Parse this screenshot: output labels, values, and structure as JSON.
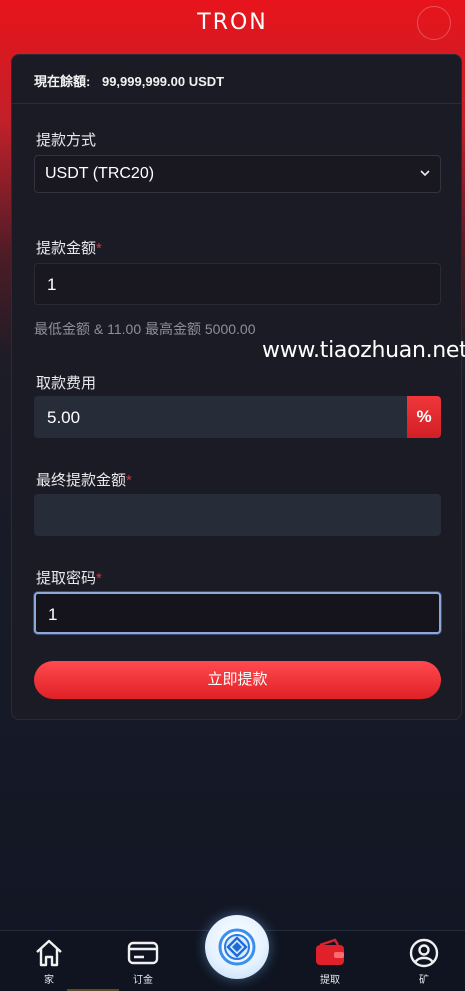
{
  "header": {
    "logo_text": "TRON"
  },
  "balance": {
    "label": "現在餘額:",
    "value": "99,999,999.00 USDT"
  },
  "form": {
    "method_label": "提款方式",
    "method_value": "USDT (TRC20)",
    "amount_label": "提款金额",
    "amount_value": "1",
    "amount_hint": "最低金额 & 11.00 最高金额 5000.00",
    "fee_label": "取款费用",
    "fee_value": "5.00",
    "fee_unit": "%",
    "final_label": "最终提款金额",
    "final_value": "",
    "password_label": "提取密码",
    "password_value": "1",
    "required_mark": "*",
    "submit_label": "立即提款"
  },
  "watermark": "www.tiaozhuan.net",
  "tabbar": {
    "items": [
      {
        "label": "家",
        "icon": "home-icon"
      },
      {
        "label": "订金",
        "icon": "card-icon"
      },
      {
        "label": "",
        "icon": "center-logo-icon"
      },
      {
        "label": "提取",
        "icon": "wallet-icon"
      },
      {
        "label": "矿",
        "icon": "user-icon"
      }
    ]
  },
  "colors": {
    "accent": "#e8141b",
    "background": "#171a27",
    "card": "#1b1b25",
    "hint": "#8d8f98"
  }
}
